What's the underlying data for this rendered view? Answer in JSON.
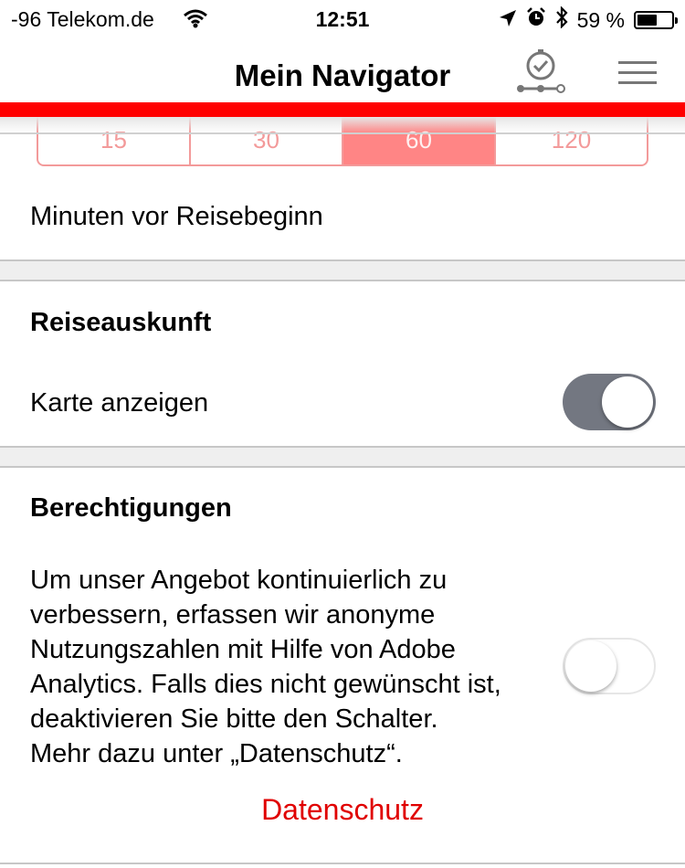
{
  "status_bar": {
    "carrier": "-96 Telekom.de",
    "time": "12:51",
    "battery_text": "59 %",
    "battery_level": 0.59,
    "icons": [
      "wifi-icon",
      "location-arrow-icon",
      "alarm-clock-icon",
      "bluetooth-icon",
      "battery-icon"
    ]
  },
  "nav": {
    "title": "Mein Navigator",
    "icons": [
      "timer-route-icon",
      "hamburger-menu-icon"
    ],
    "accent_color": "#ff0000"
  },
  "minutes": {
    "options": [
      "15",
      "30",
      "60",
      "120"
    ],
    "selected": "60",
    "label": "Minuten vor Reisebeginn"
  },
  "reiseauskunft": {
    "title": "Reiseauskunft",
    "map_label": "Karte anzeigen",
    "map_enabled": true
  },
  "permissions": {
    "title": "Berechtigungen",
    "description_lines": [
      "Um unser Angebot kontinuierlich zu",
      "verbessern, erfassen wir anonyme",
      "Nutzungszahlen mit Hilfe von Adobe",
      "Analytics. Falls dies nicht gewünscht ist,",
      "deaktivieren Sie bitte den Schalter.",
      "Mehr dazu unter „Datenschutz“."
    ],
    "analytics_enabled": false,
    "link": "Datenschutz",
    "link_color": "#e00000"
  }
}
